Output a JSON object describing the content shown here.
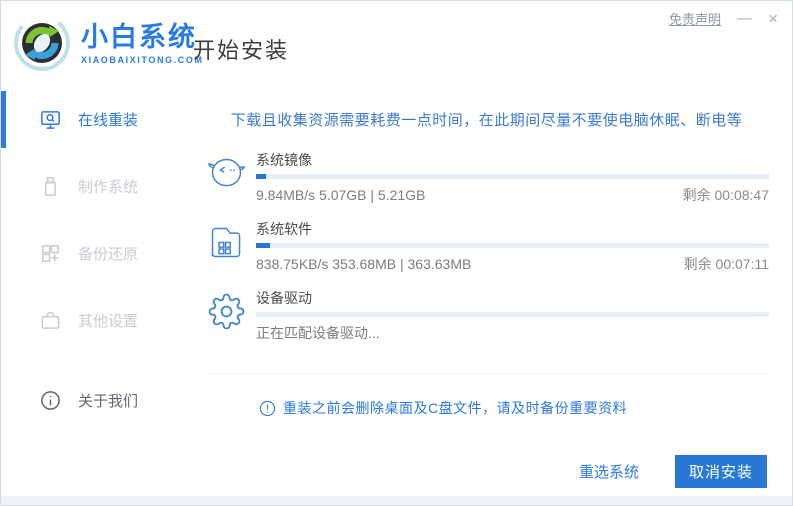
{
  "window": {
    "disclaimer": "免责声明",
    "minimize": "—",
    "close": "×"
  },
  "header": {
    "logo_title": "小白系统",
    "logo_subtitle": "XIAOBAIXITONG.COM",
    "page_title": "开始安装"
  },
  "sidebar": {
    "items": [
      {
        "label": "在线重装",
        "icon": "monitor-reinstall-icon",
        "active": true
      },
      {
        "label": "制作系统",
        "icon": "usb-drive-icon",
        "active": false
      },
      {
        "label": "备份还原",
        "icon": "backup-grid-icon",
        "active": false
      },
      {
        "label": "其他设置",
        "icon": "briefcase-icon",
        "active": false
      },
      {
        "label": "关于我们",
        "icon": "info-circle-icon",
        "active": false
      }
    ]
  },
  "main": {
    "top_notice": "下载且收集资源需要耗费一点时间，在此期间尽量不要使电脑休眠、断电等",
    "tasks": [
      {
        "name": "系统镜像",
        "detail": "9.84MB/s 5.07GB | 5.21GB",
        "remaining": "剩余 00:08:47",
        "progress_percent": 2,
        "icon": "mascot-face-icon"
      },
      {
        "name": "系统软件",
        "detail": "838.75KB/s 353.68MB | 363.63MB",
        "remaining": "剩余 00:07:11",
        "progress_percent": 2.7,
        "icon": "folder-apps-icon"
      },
      {
        "name": "设备驱动",
        "detail": "正在匹配设备驱动...",
        "remaining": "",
        "progress_percent": 0,
        "icon": "gear-icon"
      }
    ],
    "warning": "重装之前会删除桌面及C盘文件，请及时备份重要资料"
  },
  "footer": {
    "reselect_label": "重选系统",
    "cancel_label": "取消安装",
    "overall_progress_percent": 0
  },
  "colors": {
    "accent": "#2a7ae4",
    "progress_fill": "#2577cd",
    "progress_track": "#e7eefa",
    "cancel_button_bg": "#2878d6",
    "notice_text": "#3a7bd5"
  }
}
